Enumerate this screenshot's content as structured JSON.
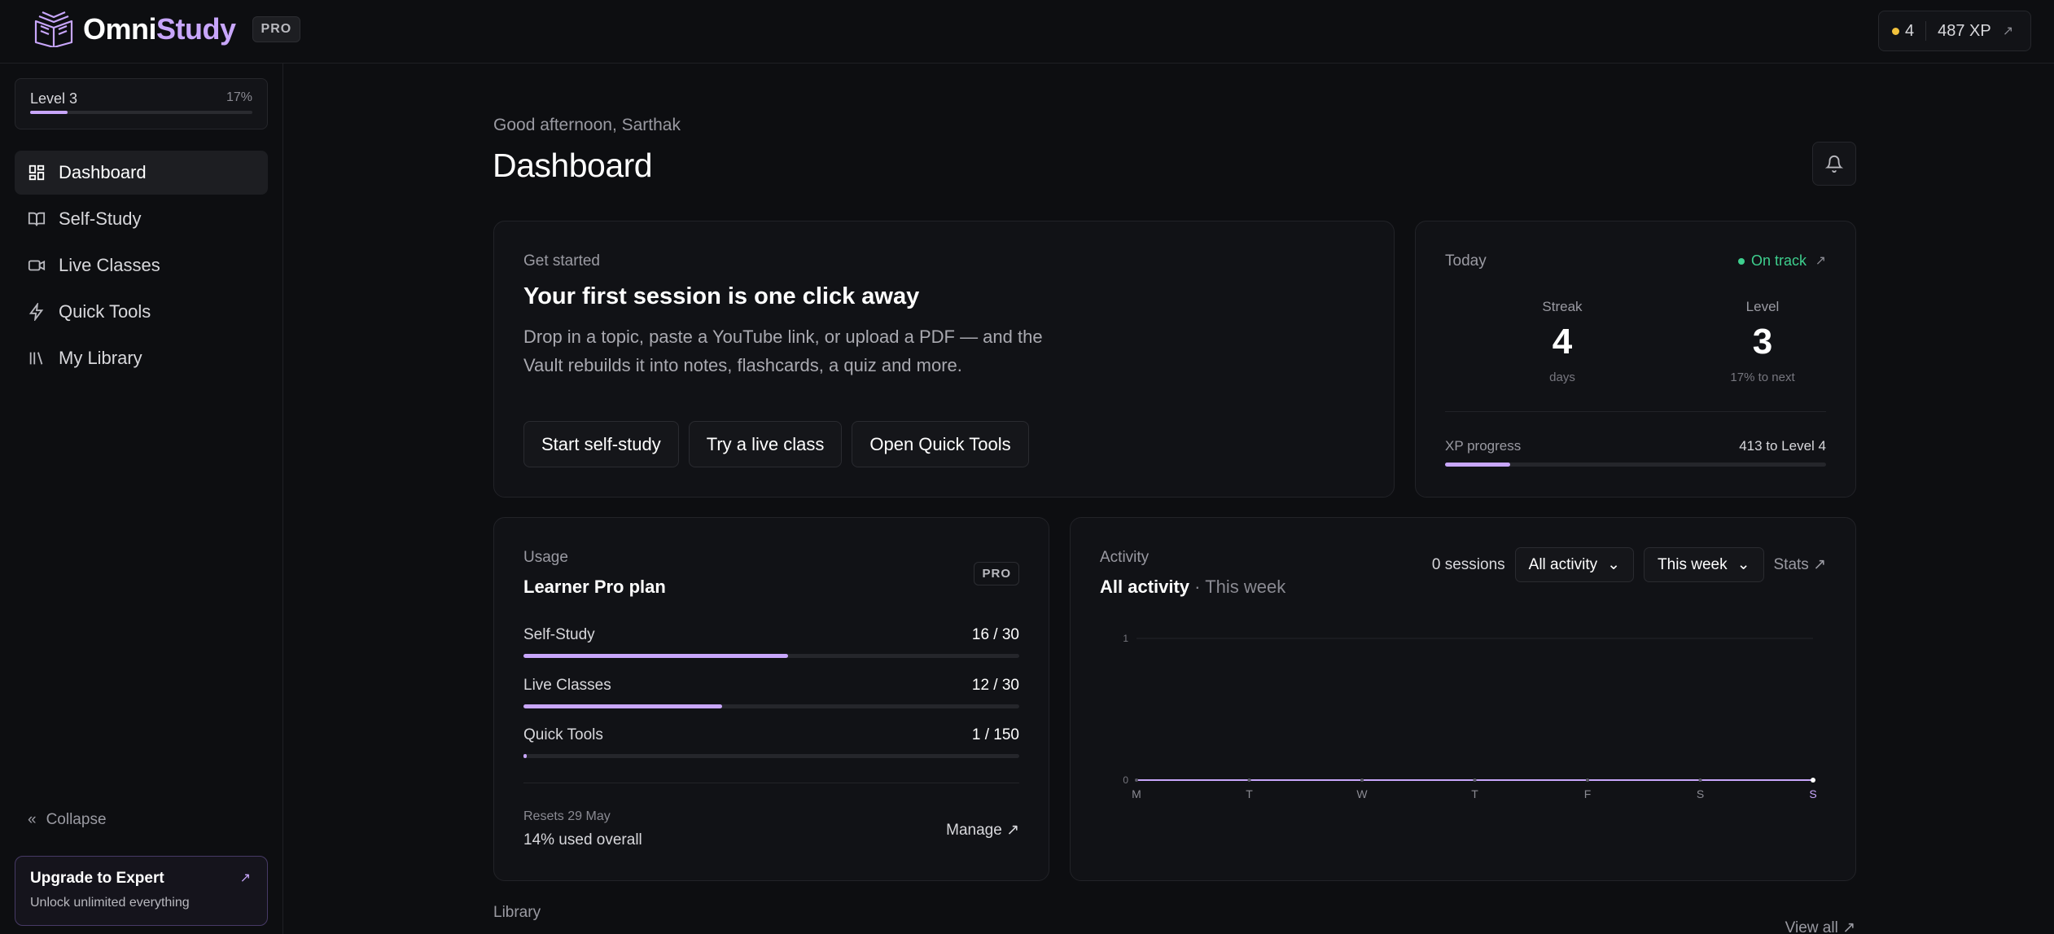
{
  "app": {
    "brand_a": "Omni",
    "brand_b": "Study",
    "plan_chip": "PRO"
  },
  "header": {
    "coins": "4",
    "xp": "487 XP",
    "xp_arrow": "↗",
    "accent": "#c8a6fb",
    "coin_color": "#f2c23c"
  },
  "sidebar": {
    "level_label": "Level 3",
    "level_pct_label": "17%",
    "level_progress": 0.17,
    "items": [
      {
        "label": "Dashboard",
        "icon": "dashboard-icon",
        "active": true
      },
      {
        "label": "Self-Study",
        "icon": "book-icon",
        "active": false
      },
      {
        "label": "Live Classes",
        "icon": "video-icon",
        "active": false
      },
      {
        "label": "Quick Tools",
        "icon": "lightning-icon",
        "active": false
      },
      {
        "label": "My Library",
        "icon": "library-icon",
        "active": false
      }
    ],
    "collapse_label": "Collapse",
    "upgrade": {
      "title": "Upgrade to Expert",
      "subtitle": "Unlock unlimited everything",
      "arrow": "↗"
    }
  },
  "main": {
    "greeting": "Good afternoon, Sarthak",
    "title": "Dashboard",
    "get_started": {
      "eyebrow": "Get started",
      "heading": "Your first session is one click away",
      "body": "Drop in a topic, paste a YouTube link, or upload a PDF — and the Vault rebuilds it into notes, flashcards, a quiz and more.",
      "buttons": [
        "Start self-study",
        "Try a live class",
        "Open Quick Tools"
      ]
    },
    "today": {
      "eyebrow": "Today",
      "status": "On track",
      "status_color": "#3ecf8e",
      "ext_arrow": "↗",
      "streak": {
        "label": "Streak",
        "value": "4",
        "unit": "days"
      },
      "level": {
        "label": "Level",
        "value": "3",
        "unit": "17% to next"
      },
      "xp_label": "XP progress",
      "xp_right": "413 to Level 4",
      "xp_progress": 0.17
    },
    "usage": {
      "eyebrow": "Usage",
      "plan": "Learner Pro plan",
      "chip": "PRO",
      "rows": [
        {
          "name": "Self-Study",
          "count": "16 / 30",
          "progress": 0.533
        },
        {
          "name": "Live Classes",
          "count": "12 / 30",
          "progress": 0.4
        },
        {
          "name": "Quick Tools",
          "count": "1 / 150",
          "progress": 0.0067
        }
      ],
      "resets": "Resets 29 May",
      "used": "14% used overall",
      "manage": "Manage ↗"
    },
    "activity": {
      "eyebrow": "Activity",
      "title_bold": "All activity",
      "title_rest": " · This week",
      "sessions": "0 sessions",
      "filter_1": "All activity",
      "filter_2": "This week",
      "stats": "Stats ↗"
    },
    "library": {
      "label": "Library",
      "view_all": "View all ↗"
    }
  },
  "chart_data": {
    "type": "line",
    "categories": [
      "M",
      "T",
      "W",
      "T",
      "F",
      "S",
      "S"
    ],
    "series": [
      {
        "values": [
          0,
          0,
          0,
          0,
          0,
          0,
          0
        ]
      }
    ],
    "ylim": [
      0,
      1
    ],
    "yticks": [
      0,
      1
    ],
    "highlight_index": 6,
    "grid": true,
    "color": "#c8a6fb"
  }
}
